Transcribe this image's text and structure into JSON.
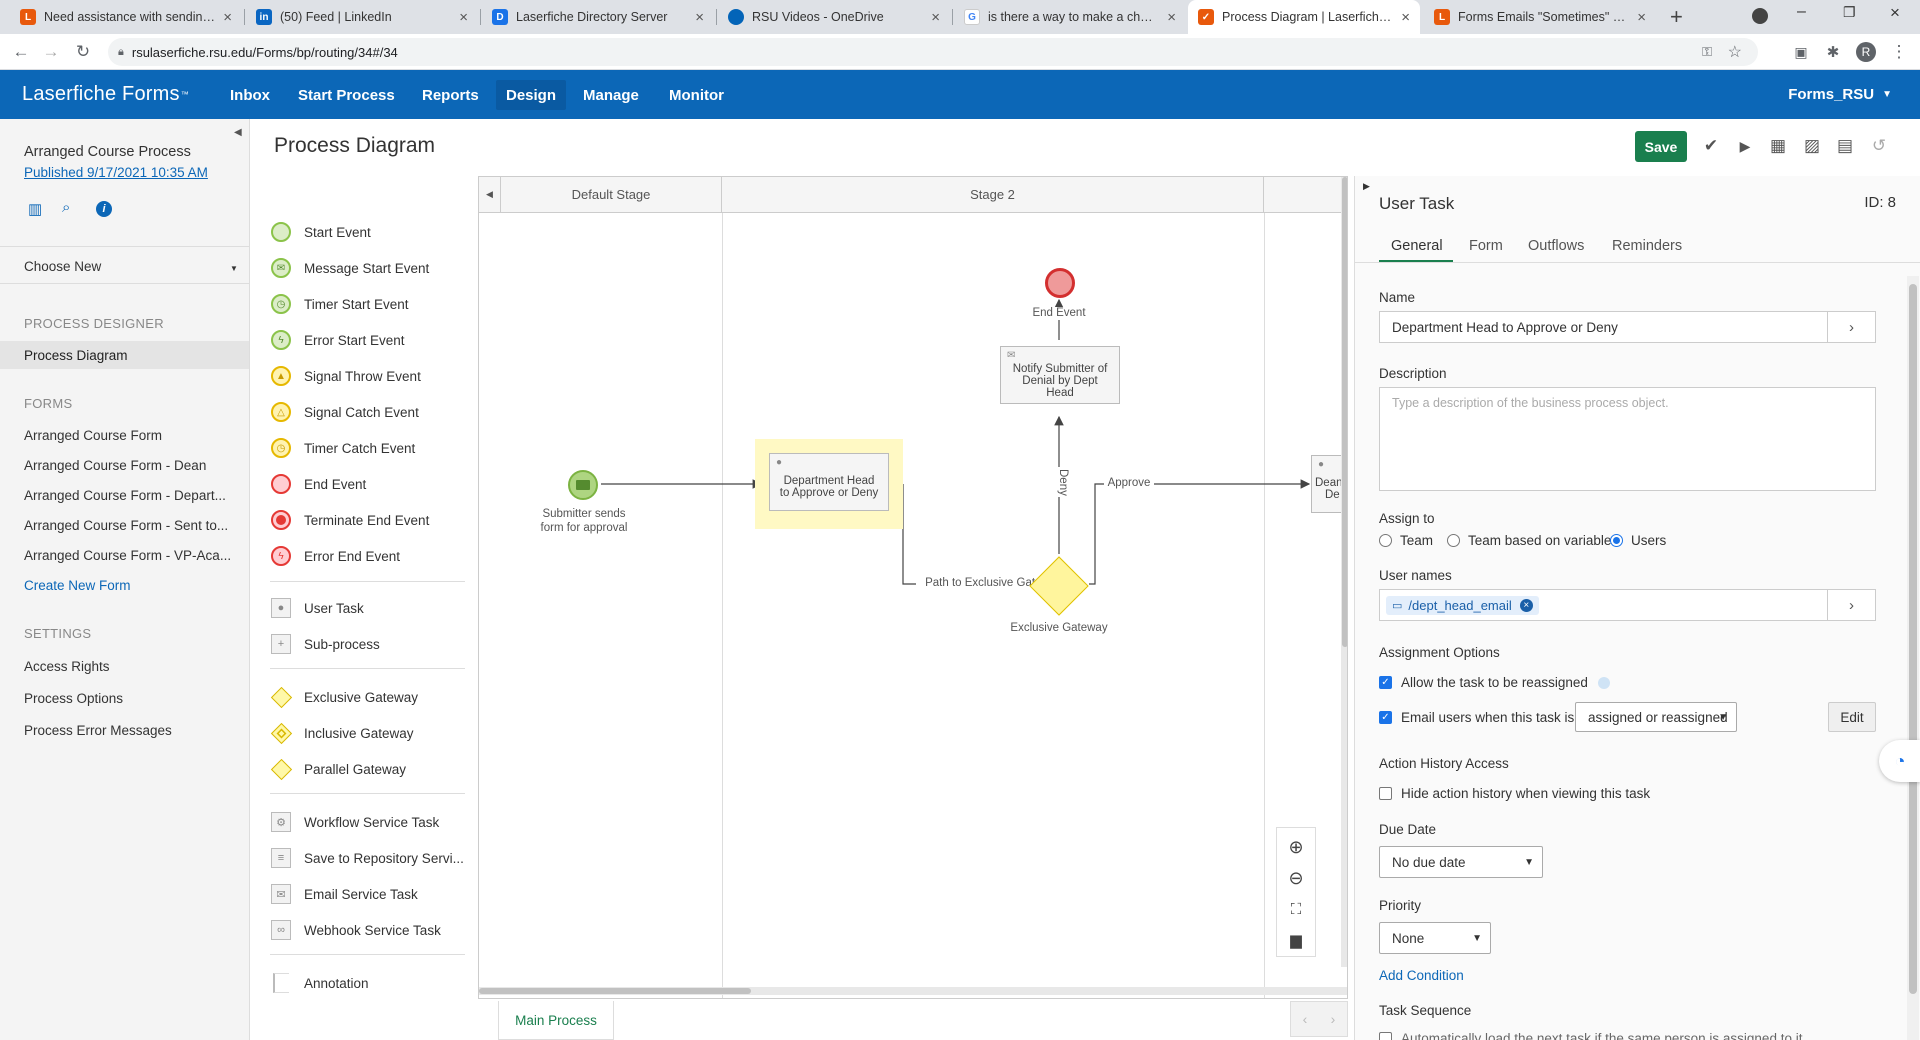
{
  "browser": {
    "tabs": [
      {
        "title": "Need assistance with sending at",
        "color": "#e8590c",
        "icon": "laserfiche-answers-icon"
      },
      {
        "title": "(50) Feed | LinkedIn",
        "color": "#0a66c2",
        "icon": "linkedin-icon"
      },
      {
        "title": "Laserfiche Directory Server",
        "color": "#1a73e8",
        "icon": "directory-server-icon"
      },
      {
        "title": "RSU Videos - OneDrive",
        "color": "#0364b8",
        "icon": "onedrive-icon"
      },
      {
        "title": "is there a way to make a change",
        "color": "#4285f4",
        "icon": "google-icon"
      },
      {
        "title": "Process Diagram | Laserfiche Fo",
        "color": "#e8590c",
        "icon": "laserfiche-forms-icon"
      },
      {
        "title": "Forms Emails \"Sometimes\" Fail t",
        "color": "#e8590c",
        "icon": "laserfiche-answers-icon"
      }
    ],
    "url": "rsulaserfiche.rsu.edu/Forms/bp/routing/34#/34",
    "profile_initial": "R"
  },
  "header": {
    "brand": "Laserfiche Forms",
    "brand_tm": "™",
    "nav": [
      "Inbox",
      "Start Process",
      "Reports",
      "Design",
      "Manage",
      "Monitor"
    ],
    "active_nav": "Design",
    "user": "Forms_RSU"
  },
  "sidebar": {
    "process_name": "Arranged Course Process",
    "published": "Published 9/17/2021 10:35 AM",
    "choose_new": "Choose New",
    "section_designer": "PROCESS DESIGNER",
    "process_diagram": "Process Diagram",
    "section_forms": "FORMS",
    "forms": [
      "Arranged Course Form",
      "Arranged Course Form - Dean",
      "Arranged Course Form - Depart...",
      "Arranged Course Form - Sent to...",
      "Arranged Course Form - VP-Aca..."
    ],
    "create_form": "Create New Form",
    "section_settings": "SETTINGS",
    "settings": [
      "Access Rights",
      "Process Options",
      "Process Error Messages"
    ]
  },
  "page_title": "Process Diagram",
  "toolbar": {
    "save_label": "Save"
  },
  "palette": {
    "events": [
      "Start Event",
      "Message Start Event",
      "Timer Start Event",
      "Error Start Event",
      "Signal Throw Event",
      "Signal Catch Event",
      "Timer Catch Event",
      "End Event",
      "Terminate End Event",
      "Error End Event"
    ],
    "tasks": [
      "User Task",
      "Sub-process"
    ],
    "gateways": [
      "Exclusive Gateway",
      "Inclusive Gateway",
      "Parallel Gateway"
    ],
    "services": [
      "Workflow Service Task",
      "Save to Repository Servi...",
      "Email Service Task",
      "Webhook Service Task"
    ],
    "annotation": "Annotation"
  },
  "diagram": {
    "stages": [
      "Default Stage",
      "Stage 2"
    ],
    "start_label_1": "Submitter sends",
    "start_label_2": "form for approval",
    "task1_line1": "Department Head",
    "task1_line2": "to Approve or Deny",
    "path_label": "Path to Exclusive Gateway",
    "gateway_label": "Exclusive Gateway",
    "deny_label": "Deny",
    "approve_label": "Approve",
    "notify_line1": "Notify Submitter of",
    "notify_line2": "Denial by Dept",
    "notify_line3": "Head",
    "end_label": "End Event",
    "dean_line1": "Dean",
    "dean_line2": "De",
    "main_tab": "Main Process"
  },
  "panel": {
    "title": "User Task",
    "id_label": "ID: 8",
    "tabs": [
      "General",
      "Form",
      "Outflows",
      "Reminders"
    ],
    "active_tab": "General",
    "name_label": "Name",
    "name_value": "Department Head to Approve or Deny",
    "desc_label": "Description",
    "desc_placeholder": "Type a description of the business process object.",
    "assign_label": "Assign to",
    "assign_options": [
      "Team",
      "Team based on variable",
      "Users"
    ],
    "assign_selected": "Users",
    "usernames_label": "User names",
    "username_token": "/dept_head_email",
    "assign_opts_label": "Assignment Options",
    "allow_reassign": "Allow the task to be reassigned",
    "email_users": "Email users when this task is",
    "email_when": "assigned or reassigned",
    "edit_label": "Edit",
    "history_label": "Action History Access",
    "hide_history": "Hide action history when viewing this task",
    "due_label": "Due Date",
    "due_value": "No due date",
    "priority_label": "Priority",
    "priority_value": "None",
    "add_condition": "Add Condition",
    "sequence_label": "Task Sequence",
    "sequence_text": "Automatically load the next task if the same person is assigned to it"
  },
  "colors": {
    "header_blue": "#0c67b7",
    "save_green": "#1a7f4e",
    "start_green": "#8bc34a",
    "end_red": "#e53935",
    "gateway_yellow": "#fff59d",
    "selection_yellow": "#fff9c4"
  }
}
